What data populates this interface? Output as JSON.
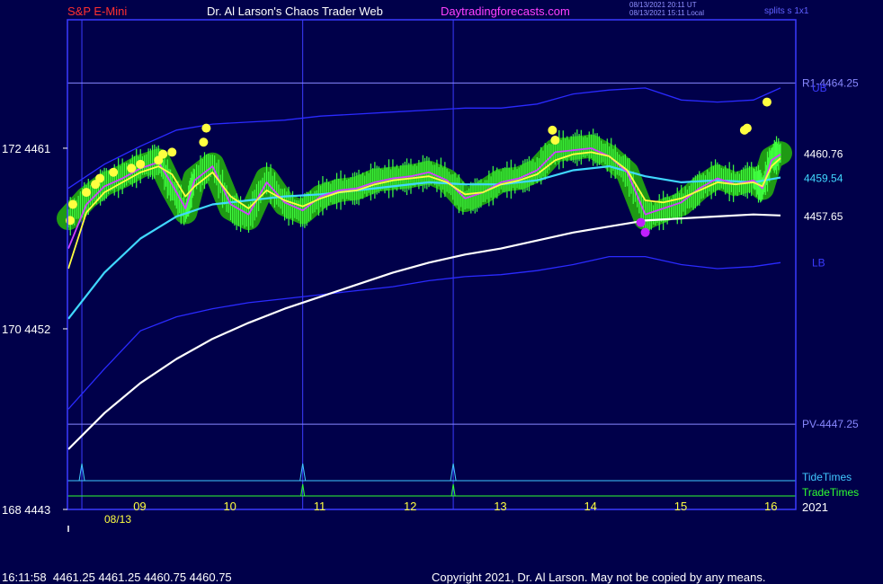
{
  "header": {
    "symbol": "S&P E-Mini",
    "author": "Dr. Al Larson's Chaos Trader Web",
    "site": "Daytradingforecasts.com",
    "timestamp_ut": "08/13/2021 20:11 UT",
    "timestamp_local": "08/13/2021 15:11 Local",
    "splits": "splits s 1x1"
  },
  "footer": {
    "quote_line": "16:11:58  4461.25 4461.25 4460.75 4460.75",
    "copyright": "Copyright 2021, Dr. Al Larson. May not be copied by any means."
  },
  "colors": {
    "background": "#00004a",
    "frame": "#3b3bff",
    "title_red": "#ff3030",
    "site_magenta": "#ff40ff",
    "green_band": "#1f9a14",
    "price_bars": "#40ff40",
    "yellow_ema": "#ffff40",
    "magenta_ema": "#d040ff",
    "cyan_ma": "#40d8ff",
    "white_ma": "#ffffff",
    "blue_band": "#2a2aff",
    "tide_line": "#40c8ff",
    "trade_line": "#30ff30"
  },
  "chart_data": {
    "type": "line",
    "x_unit": "hour of day",
    "x_ticks": [
      9,
      10,
      11,
      12,
      13,
      14,
      15,
      16
    ],
    "x_date_label": "08/13",
    "x_year_label": "2021",
    "xlim": [
      8.2,
      16.1
    ],
    "ylim": [
      4443,
      4467.4
    ],
    "y_ticks": [
      {
        "value": 4461,
        "label": "172  4461"
      },
      {
        "value": 4452,
        "label": "170  4452"
      },
      {
        "value": 4443,
        "label": "168  4443"
      }
    ],
    "levels": [
      {
        "label": "R1-4464.25",
        "value": 4464.25,
        "color": "#8888ff"
      },
      {
        "label": "PV-4447.25",
        "value": 4447.25,
        "color": "#8888ff"
      }
    ],
    "band_labels": [
      {
        "label": "UB",
        "x": 16.3,
        "value": 4464.0
      },
      {
        "label": "LB",
        "x": 16.3,
        "value": 4455.3
      }
    ],
    "value_labels": [
      {
        "label": "4460.76",
        "value": 4460.76,
        "color": "#ffffff"
      },
      {
        "label": "4459.54",
        "value": 4459.54,
        "color": "#40d8ff"
      },
      {
        "label": "4457.65",
        "value": 4457.65,
        "color": "#ffffff"
      }
    ],
    "vertical_markers": [
      8.35,
      10.8,
      12.47
    ],
    "tide_times": {
      "label": "TideTimes",
      "times": [
        8.35,
        10.8,
        12.47
      ]
    },
    "trade_times": {
      "label": "TradeTimes",
      "times": [
        10.8,
        12.47
      ]
    },
    "series": [
      {
        "name": "price",
        "kind": "bars",
        "x": [
          8.2,
          8.4,
          8.6,
          8.8,
          9.0,
          9.2,
          9.35,
          9.5,
          9.6,
          9.8,
          10.0,
          10.2,
          10.4,
          10.6,
          10.8,
          11.0,
          11.2,
          11.4,
          11.6,
          11.8,
          12.0,
          12.2,
          12.4,
          12.6,
          12.8,
          13.0,
          13.2,
          13.4,
          13.6,
          13.8,
          14.0,
          14.2,
          14.4,
          14.6,
          14.8,
          15.0,
          15.2,
          15.4,
          15.6,
          15.8,
          15.9,
          16.0,
          16.1
        ],
        "values": [
          4457.5,
          4458.5,
          4459.2,
          4459.6,
          4460.1,
          4460.4,
          4459.0,
          4457.8,
          4459.5,
          4460.2,
          4458.0,
          4457.5,
          4459.5,
          4458.2,
          4457.8,
          4458.6,
          4458.9,
          4459.0,
          4459.4,
          4459.5,
          4459.6,
          4459.8,
          4459.4,
          4458.4,
          4458.8,
          4459.4,
          4459.5,
          4459.9,
          4460.9,
          4461.0,
          4461.1,
          4460.6,
          4459.8,
          4457.5,
          4457.9,
          4458.2,
          4459.0,
          4459.6,
          4459.2,
          4459.5,
          4459.0,
          4460.5,
          4460.76
        ]
      },
      {
        "name": "fast average",
        "kind": "line",
        "color": "#ffff40",
        "x": [
          8.2,
          8.4,
          8.6,
          8.8,
          9.0,
          9.2,
          9.35,
          9.5,
          9.6,
          9.8,
          10.0,
          10.2,
          10.4,
          10.6,
          10.8,
          11.0,
          11.2,
          11.4,
          11.6,
          11.8,
          12.0,
          12.2,
          12.4,
          12.6,
          12.8,
          13.0,
          13.2,
          13.4,
          13.6,
          13.8,
          14.0,
          14.2,
          14.4,
          14.6,
          14.8,
          15.0,
          15.2,
          15.4,
          15.6,
          15.8,
          15.9,
          16.0,
          16.1
        ],
        "values": [
          4455.0,
          4457.8,
          4458.8,
          4459.3,
          4459.8,
          4460.1,
          4459.7,
          4458.6,
          4459.1,
          4459.8,
          4458.6,
          4458.0,
          4458.9,
          4458.4,
          4458.1,
          4458.5,
          4458.8,
          4458.9,
          4459.2,
          4459.4,
          4459.5,
          4459.6,
          4459.3,
          4458.7,
          4458.8,
          4459.2,
          4459.4,
          4459.7,
          4460.4,
          4460.7,
          4460.8,
          4460.6,
          4459.9,
          4458.4,
          4458.3,
          4458.5,
          4458.9,
          4459.3,
          4459.2,
          4459.3,
          4459.1,
          4460.1,
          4460.5
        ]
      },
      {
        "name": "magenta average",
        "kind": "line",
        "color": "#d040ff",
        "x": [
          8.2,
          8.4,
          8.6,
          8.8,
          9.0,
          9.2,
          9.35,
          9.5,
          9.6,
          9.8,
          10.0,
          10.2,
          10.4,
          10.6,
          10.8,
          11.0,
          11.2,
          11.4,
          11.6,
          11.8,
          12.0,
          12.2,
          12.4,
          12.6,
          12.8,
          13.0,
          13.2,
          13.4,
          13.6,
          13.8,
          14.0,
          14.2,
          14.4,
          14.6,
          14.8,
          15.0,
          15.2,
          15.4,
          15.6,
          15.8,
          15.9,
          16.0,
          16.1
        ],
        "values": [
          4456.0,
          4458.2,
          4459.1,
          4459.5,
          4460.0,
          4460.3,
          4459.2,
          4458.0,
          4459.4,
          4460.1,
          4458.2,
          4457.7,
          4459.3,
          4458.3,
          4457.9,
          4458.6,
          4458.9,
          4459.0,
          4459.3,
          4459.5,
          4459.6,
          4459.8,
          4459.4,
          4458.5,
          4458.8,
          4459.3,
          4459.5,
          4459.9,
          4460.8,
          4460.9,
          4461.0,
          4460.6,
          4459.8,
          4457.7,
          4458.0,
          4458.3,
          4459.0,
          4459.5,
          4459.2,
          4459.4,
          4459.0,
          4460.4,
          4460.7
        ]
      },
      {
        "name": "cyan average",
        "kind": "line",
        "color": "#40d8ff",
        "x": [
          8.2,
          8.6,
          9.0,
          9.4,
          9.8,
          10.2,
          10.6,
          11.0,
          11.4,
          11.8,
          12.2,
          12.6,
          13.0,
          13.4,
          13.8,
          14.2,
          14.6,
          15.0,
          15.4,
          15.8,
          16.1
        ],
        "values": [
          4452.5,
          4454.8,
          4456.5,
          4457.6,
          4458.2,
          4458.4,
          4458.6,
          4458.7,
          4458.9,
          4459.1,
          4459.3,
          4459.2,
          4459.2,
          4459.4,
          4459.9,
          4460.1,
          4459.6,
          4459.3,
          4459.4,
          4459.3,
          4459.54
        ]
      },
      {
        "name": "white average",
        "kind": "line",
        "color": "#ffffff",
        "x": [
          8.2,
          8.6,
          9.0,
          9.4,
          9.8,
          10.2,
          10.6,
          11.0,
          11.4,
          11.8,
          12.2,
          12.6,
          13.0,
          13.4,
          13.8,
          14.2,
          14.6,
          15.0,
          15.4,
          15.8,
          16.1
        ],
        "values": [
          4446.0,
          4447.8,
          4449.3,
          4450.5,
          4451.5,
          4452.3,
          4453.0,
          4453.6,
          4454.2,
          4454.8,
          4455.3,
          4455.7,
          4456.0,
          4456.4,
          4456.8,
          4457.1,
          4457.4,
          4457.5,
          4457.6,
          4457.7,
          4457.65
        ]
      },
      {
        "name": "upper band",
        "kind": "line",
        "color": "#2a2aff",
        "x": [
          8.2,
          8.6,
          9.0,
          9.4,
          9.8,
          10.2,
          10.6,
          11.0,
          11.4,
          11.8,
          12.2,
          12.6,
          13.0,
          13.4,
          13.8,
          14.2,
          14.6,
          15.0,
          15.4,
          15.8,
          16.1
        ],
        "values": [
          4459.0,
          4460.2,
          4461.1,
          4461.9,
          4462.2,
          4462.3,
          4462.4,
          4462.6,
          4462.7,
          4462.8,
          4462.9,
          4463.0,
          4463.0,
          4463.2,
          4463.7,
          4463.9,
          4464.0,
          4463.4,
          4463.3,
          4463.4,
          4464.0
        ]
      },
      {
        "name": "lower band",
        "kind": "line",
        "color": "#2a2aff",
        "x": [
          8.2,
          8.6,
          9.0,
          9.4,
          9.8,
          10.2,
          10.6,
          11.0,
          11.4,
          11.8,
          12.2,
          12.6,
          13.0,
          13.4,
          13.8,
          14.2,
          14.6,
          15.0,
          15.4,
          15.8,
          16.1
        ],
        "values": [
          4448.0,
          4450.0,
          4451.9,
          4452.6,
          4453.0,
          4453.3,
          4453.5,
          4453.7,
          4453.9,
          4454.1,
          4454.4,
          4454.6,
          4454.7,
          4454.9,
          4455.2,
          4455.6,
          4455.6,
          4455.2,
          4455.0,
          4455.1,
          4455.3
        ]
      }
    ],
    "yellow_dots": [
      {
        "x": 8.22,
        "value": 4457.4
      },
      {
        "x": 8.25,
        "value": 4458.2
      },
      {
        "x": 8.4,
        "value": 4458.8
      },
      {
        "x": 8.5,
        "value": 4459.2
      },
      {
        "x": 8.55,
        "value": 4459.5
      },
      {
        "x": 8.7,
        "value": 4459.8
      },
      {
        "x": 8.9,
        "value": 4460.0
      },
      {
        "x": 9.0,
        "value": 4460.2
      },
      {
        "x": 9.2,
        "value": 4460.4
      },
      {
        "x": 9.25,
        "value": 4460.7
      },
      {
        "x": 9.35,
        "value": 4460.8
      },
      {
        "x": 9.7,
        "value": 4461.3
      },
      {
        "x": 9.73,
        "value": 4462.0
      },
      {
        "x": 13.6,
        "value": 4461.4
      },
      {
        "x": 13.57,
        "value": 4461.9
      },
      {
        "x": 15.7,
        "value": 4461.9
      },
      {
        "x": 15.73,
        "value": 4462.0
      },
      {
        "x": 15.95,
        "value": 4463.3
      }
    ],
    "magenta_dots": [
      {
        "x": 14.55,
        "value": 4457.3
      },
      {
        "x": 14.6,
        "value": 4456.8
      }
    ]
  }
}
